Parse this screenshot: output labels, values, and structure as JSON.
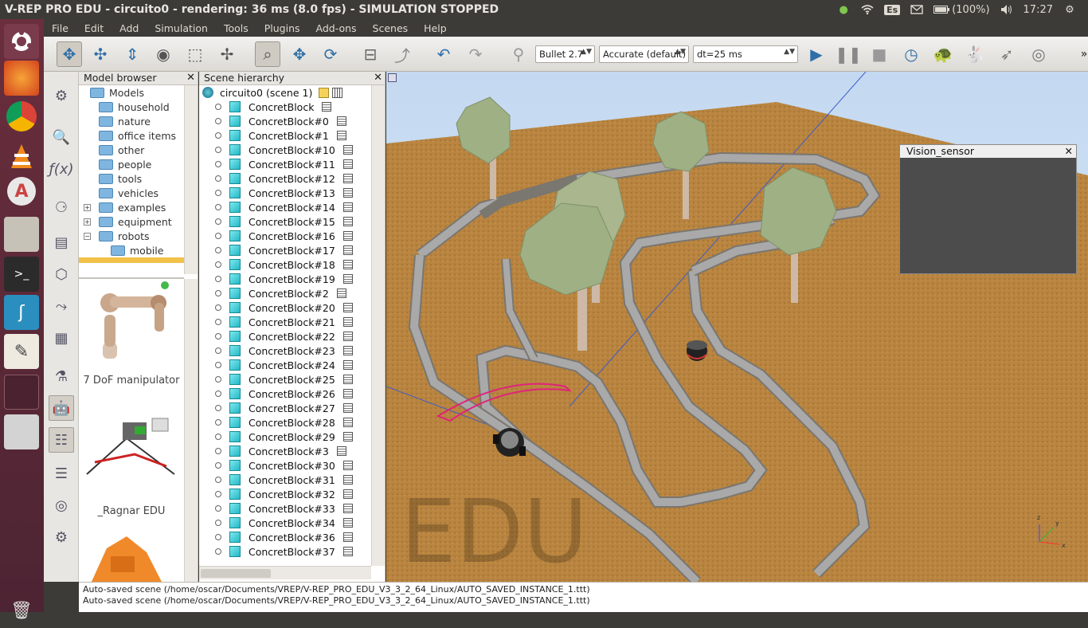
{
  "window": {
    "title": "V-REP PRO EDU - circuito0 - rendering: 36 ms (8.0 fps) - SIMULATION STOPPED"
  },
  "tray": {
    "keyboard": "Es",
    "battery": "(100%)",
    "clock": "17:27"
  },
  "menu": [
    "File",
    "Edit",
    "Add",
    "Simulation",
    "Tools",
    "Plugins",
    "Add-ons",
    "Scenes",
    "Help"
  ],
  "toolbar": {
    "engine": "Bullet 2.7",
    "accuracy": "Accurate (default)",
    "timestep": "dt=25 ms"
  },
  "model_browser": {
    "title": "Model browser",
    "folders": [
      {
        "label": "Models",
        "level": 0,
        "expander": ""
      },
      {
        "label": "household",
        "level": 1,
        "expander": ""
      },
      {
        "label": "nature",
        "level": 1,
        "expander": ""
      },
      {
        "label": "office items",
        "level": 1,
        "expander": ""
      },
      {
        "label": "other",
        "level": 1,
        "expander": ""
      },
      {
        "label": "people",
        "level": 1,
        "expander": ""
      },
      {
        "label": "tools",
        "level": 1,
        "expander": ""
      },
      {
        "label": "vehicles",
        "level": 1,
        "expander": ""
      },
      {
        "label": "examples",
        "level": 1,
        "expander": "+"
      },
      {
        "label": "equipment",
        "level": 1,
        "expander": "+"
      },
      {
        "label": "robots",
        "level": 1,
        "expander": "−"
      },
      {
        "label": "mobile",
        "level": 2,
        "expander": ""
      }
    ],
    "thumbnails": [
      "7 DoF manipulator",
      "_Ragnar EDU"
    ]
  },
  "scene_hierarchy": {
    "title": "Scene hierarchy",
    "root": "circuito0 (scene 1)",
    "items": [
      "ConcretBlock",
      "ConcretBlock#0",
      "ConcretBlock#1",
      "ConcretBlock#10",
      "ConcretBlock#11",
      "ConcretBlock#12",
      "ConcretBlock#13",
      "ConcretBlock#14",
      "ConcretBlock#15",
      "ConcretBlock#16",
      "ConcretBlock#17",
      "ConcretBlock#18",
      "ConcretBlock#19",
      "ConcretBlock#2",
      "ConcretBlock#20",
      "ConcretBlock#21",
      "ConcretBlock#22",
      "ConcretBlock#23",
      "ConcretBlock#24",
      "ConcretBlock#25",
      "ConcretBlock#26",
      "ConcretBlock#27",
      "ConcretBlock#28",
      "ConcretBlock#29",
      "ConcretBlock#3",
      "ConcretBlock#30",
      "ConcretBlock#31",
      "ConcretBlock#32",
      "ConcretBlock#33",
      "ConcretBlock#34",
      "ConcretBlock#36",
      "ConcretBlock#37"
    ]
  },
  "viewport": {
    "watermark": "EDU",
    "vision_sensor_title": "Vision_sensor",
    "axis_labels": {
      "x": "x",
      "y": "y",
      "z": "z"
    }
  },
  "console": {
    "lines": [
      "Auto-saved scene (/home/oscar/Documents/VREP/V-REP_PRO_EDU_V3_3_2_64_Linux/AUTO_SAVED_INSTANCE_1.ttt)",
      "Auto-saved scene (/home/oscar/Documents/VREP/V-REP_PRO_EDU_V3_3_2_64_Linux/AUTO_SAVED_INSTANCE_1.ttt)"
    ]
  },
  "colors": {
    "ground": "#b8843f",
    "wall": "#aaaaaa",
    "tree_crown": "#9fb084",
    "launcher": "#5a2a3a"
  }
}
